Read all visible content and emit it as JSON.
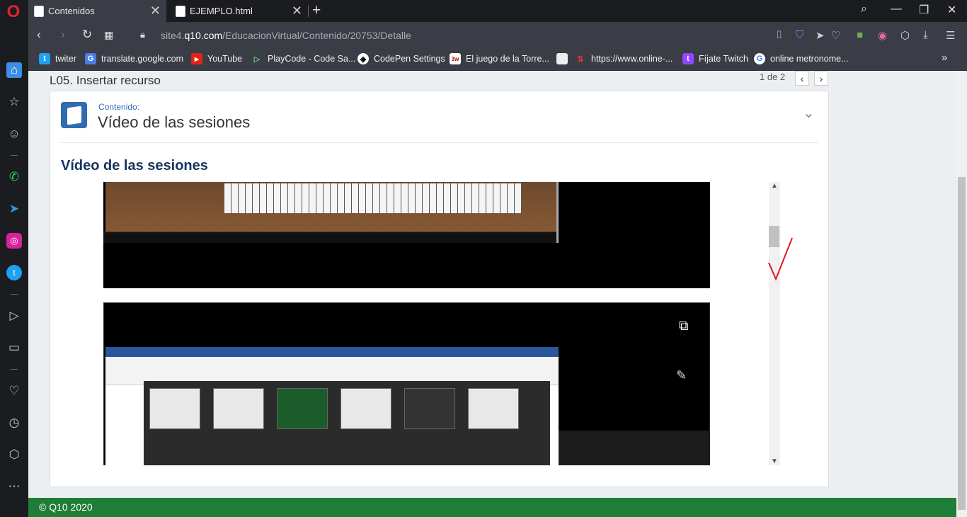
{
  "browser": {
    "tabs": [
      {
        "title": "Contenidos",
        "active": true
      },
      {
        "title": "EJEMPLO.html",
        "active": false
      }
    ],
    "url_host_prefix": "site4.",
    "url_host_main": "q10.com",
    "url_path": "/EducacionVirtual/Contenido/20753/Detalle",
    "bookmarks": [
      {
        "label": "twiter",
        "icon": "twitter-icon"
      },
      {
        "label": "translate.google.com",
        "icon": "google-translate-icon"
      },
      {
        "label": "YouTube",
        "icon": "youtube-icon"
      },
      {
        "label": "PlayCode - Code Sa...",
        "icon": "playcode-icon"
      },
      {
        "label": "CodePen Settings",
        "icon": "codepen-icon"
      },
      {
        "label": "El juego de la Torre...",
        "icon": "w3-icon"
      },
      {
        "label": "",
        "icon": "document-icon"
      },
      {
        "label": "https://www.online-...",
        "icon": "arrows-icon"
      },
      {
        "label": "Fíjate Twitch",
        "icon": "twitch-icon"
      },
      {
        "label": "online metronome...",
        "icon": "google-icon"
      }
    ],
    "more_bookmarks": "»"
  },
  "page": {
    "lesson_title": "L05. Insertar recurso",
    "pager_text": "1 de 2",
    "card": {
      "content_label": "Contenido:",
      "content_title": "Vídeo de las sesiones",
      "section_title": "Vídeo de las sesiones"
    },
    "footer": "© Q10 2020"
  },
  "colors": {
    "footer_bg": "#1e7d36",
    "section_title": "#16345f",
    "accent_blue": "#2f6db0"
  }
}
